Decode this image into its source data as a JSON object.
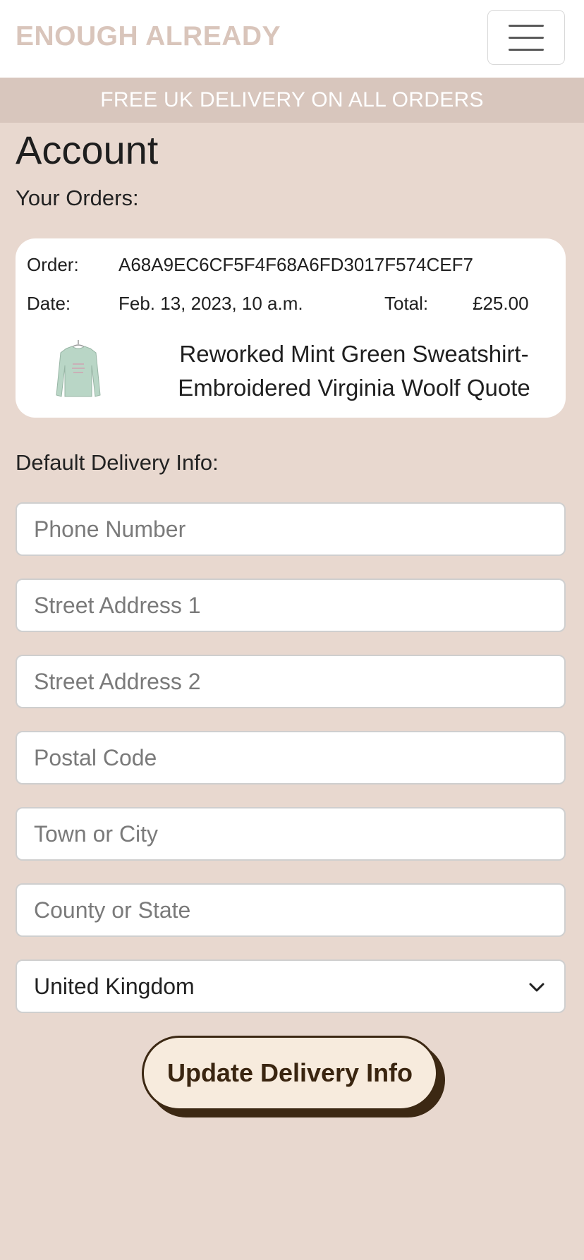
{
  "header": {
    "brand": "ENOUGH ALREADY",
    "menu_icon": "hamburger-menu-icon"
  },
  "banner": {
    "text": "FREE UK DELIVERY ON ALL ORDERS"
  },
  "page": {
    "title": "Account",
    "orders_label": "Your Orders:",
    "delivery_label": "Default Delivery Info:"
  },
  "order": {
    "order_label": "Order:",
    "order_number": "A68A9EC6CF5F4F68A6FD3017F574CEF7",
    "date_label": "Date:",
    "date": "Feb. 13, 2023, 10 a.m.",
    "total_label": "Total:",
    "total": "£25.00",
    "item": {
      "name_line1": "Reworked Mint Green Sweatshirt-",
      "name_line2": "Embroidered Virginia Woolf Quote",
      "image_icon": "mint-sweatshirt-thumbnail"
    }
  },
  "form": {
    "phone_placeholder": "Phone Number",
    "street1_placeholder": "Street Address 1",
    "street2_placeholder": "Street Address 2",
    "postcode_placeholder": "Postal Code",
    "town_placeholder": "Town or City",
    "county_placeholder": "County or State",
    "country_selected": "United Kingdom",
    "submit_label": "Update Delivery Info"
  },
  "colors": {
    "background": "#e8d8cf",
    "brand": "#d9c5bb",
    "banner": "#d8c6bd",
    "button_fill": "#f7ebdd",
    "button_border": "#3c2813"
  }
}
